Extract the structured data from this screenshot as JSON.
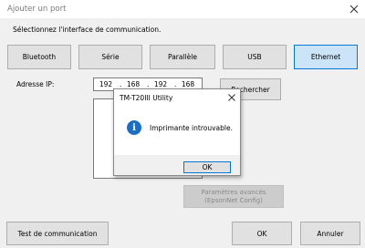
{
  "window": {
    "title": "Ajouter un port",
    "prompt": "Sélectionnez l'interface de communication."
  },
  "tabs": [
    {
      "label": "Bluetooth",
      "selected": false
    },
    {
      "label": "Série",
      "selected": false
    },
    {
      "label": "Parallèle",
      "selected": false
    },
    {
      "label": "USB",
      "selected": false
    },
    {
      "label": "Ethernet",
      "selected": true
    }
  ],
  "ip": {
    "label": "Adresse IP:",
    "octets": [
      "192",
      "168",
      "192",
      "168"
    ]
  },
  "buttons": {
    "search": "Rechercher",
    "advanced_line1": "Paramètres avancés",
    "advanced_line2": "(EpsonNet Config)",
    "test": "Test de communication",
    "ok": "OK",
    "cancel": "Annuler"
  },
  "dialog": {
    "title": "TM-T20III Utility",
    "message": "Imprimante introuvable.",
    "ok": "OK",
    "icon": "info-icon"
  },
  "colors": {
    "selected_tab_bg": "#cce4f7",
    "selected_tab_border": "#0078d7",
    "info_icon": "#1a6fc4"
  }
}
